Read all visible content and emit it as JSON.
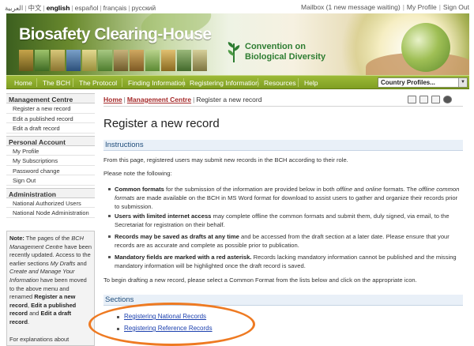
{
  "top_bar": {
    "languages": [
      "العربية",
      "中文",
      "english",
      "español",
      "français",
      "русский"
    ],
    "active_language": "english",
    "mailbox": "Mailbox (1 new message waiting)",
    "my_profile": "My Profile",
    "sign_out": "Sign Out"
  },
  "banner": {
    "site_title": "Biosafety Clearing-House",
    "partner_line1": "Convention on",
    "partner_line2": "Biological Diversity"
  },
  "nav": {
    "items": [
      "Home",
      "The BCH",
      "The Protocol",
      "Finding Information",
      "Registering Information",
      "Resources",
      "Help"
    ],
    "country_select": "Country Profiles..."
  },
  "sidebar": {
    "sections": [
      {
        "title": "Management Centre",
        "items": [
          "Register a new record",
          "Edit a published record",
          "Edit a draft record"
        ]
      },
      {
        "title": "Personal Account",
        "items": [
          "My Profile",
          "My Subscriptions",
          "Password change",
          "Sign Out"
        ]
      },
      {
        "title": "Administration",
        "items": [
          "National Authorized Users",
          "National Node Administration"
        ]
      }
    ],
    "note": {
      "label": "Note:",
      "text1": " The pages of the ",
      "text1_em": "BCH Management Centre",
      "text2": " have been recently updated. Access to the earlier sections ",
      "text2_em": "My Drafts",
      "text3": " and ",
      "text3_em": "Create and Manage Your Information",
      "text4": " have been moved to the above menu and renamed ",
      "b1": "Register a new record",
      "text5": ", ",
      "b2": "Edit a published record",
      "text6": " and ",
      "b3": "Edit a draft record",
      "text7": ".",
      "text8": "For explanations about"
    }
  },
  "main": {
    "breadcrumb": [
      "Home",
      "Management Centre",
      "Register a new record"
    ],
    "title": "Register a new record",
    "instructions": {
      "heading": "Instructions",
      "intro": "From this page, registered users may submit new records in the BCH according to their role.",
      "note_intro": "Please note the following:",
      "bullets": [
        {
          "bold": "Common formats",
          "text1": " for the submission of the information are provided below in both ",
          "em1": "offline",
          "text2": " and ",
          "em2": "online",
          "text3": " formats. The ",
          "em3": "offline common formats",
          "text4": " are made available on the BCH in MS Word format for download to assist users to gather and organize their records prior to submission."
        },
        {
          "bold": "Users with limited internet access",
          "text1": " may complete offline the common formats and submit them, duly signed, via email, to the Secretariat for registration on their behalf."
        },
        {
          "bold": "Records may be saved as drafts at any time",
          "text1": " and be accessed from the draft section at a later date. Please ensure that your records are as accurate and complete as possible prior to publication."
        },
        {
          "bold": "Mandatory fields are marked with a red asterisk.",
          "text1": " Records lacking mandatory information cannot be published and the missing mandatory information will be highlighted once the draft record is saved."
        }
      ],
      "outro": "To begin drafting a new record, please select a Common Format from the lists below and click on the appropriate icon."
    },
    "sections": {
      "heading": "Sections",
      "links": [
        "Registering National Records",
        "Registering Reference Records"
      ]
    }
  },
  "colors": {
    "nav_green": "#8aab2c",
    "section_head_bg": "#e9f0f8",
    "link_blue": "#1a3fae",
    "breadcrumb_red": "#a52a2a",
    "highlight_orange": "#ee7a22"
  }
}
